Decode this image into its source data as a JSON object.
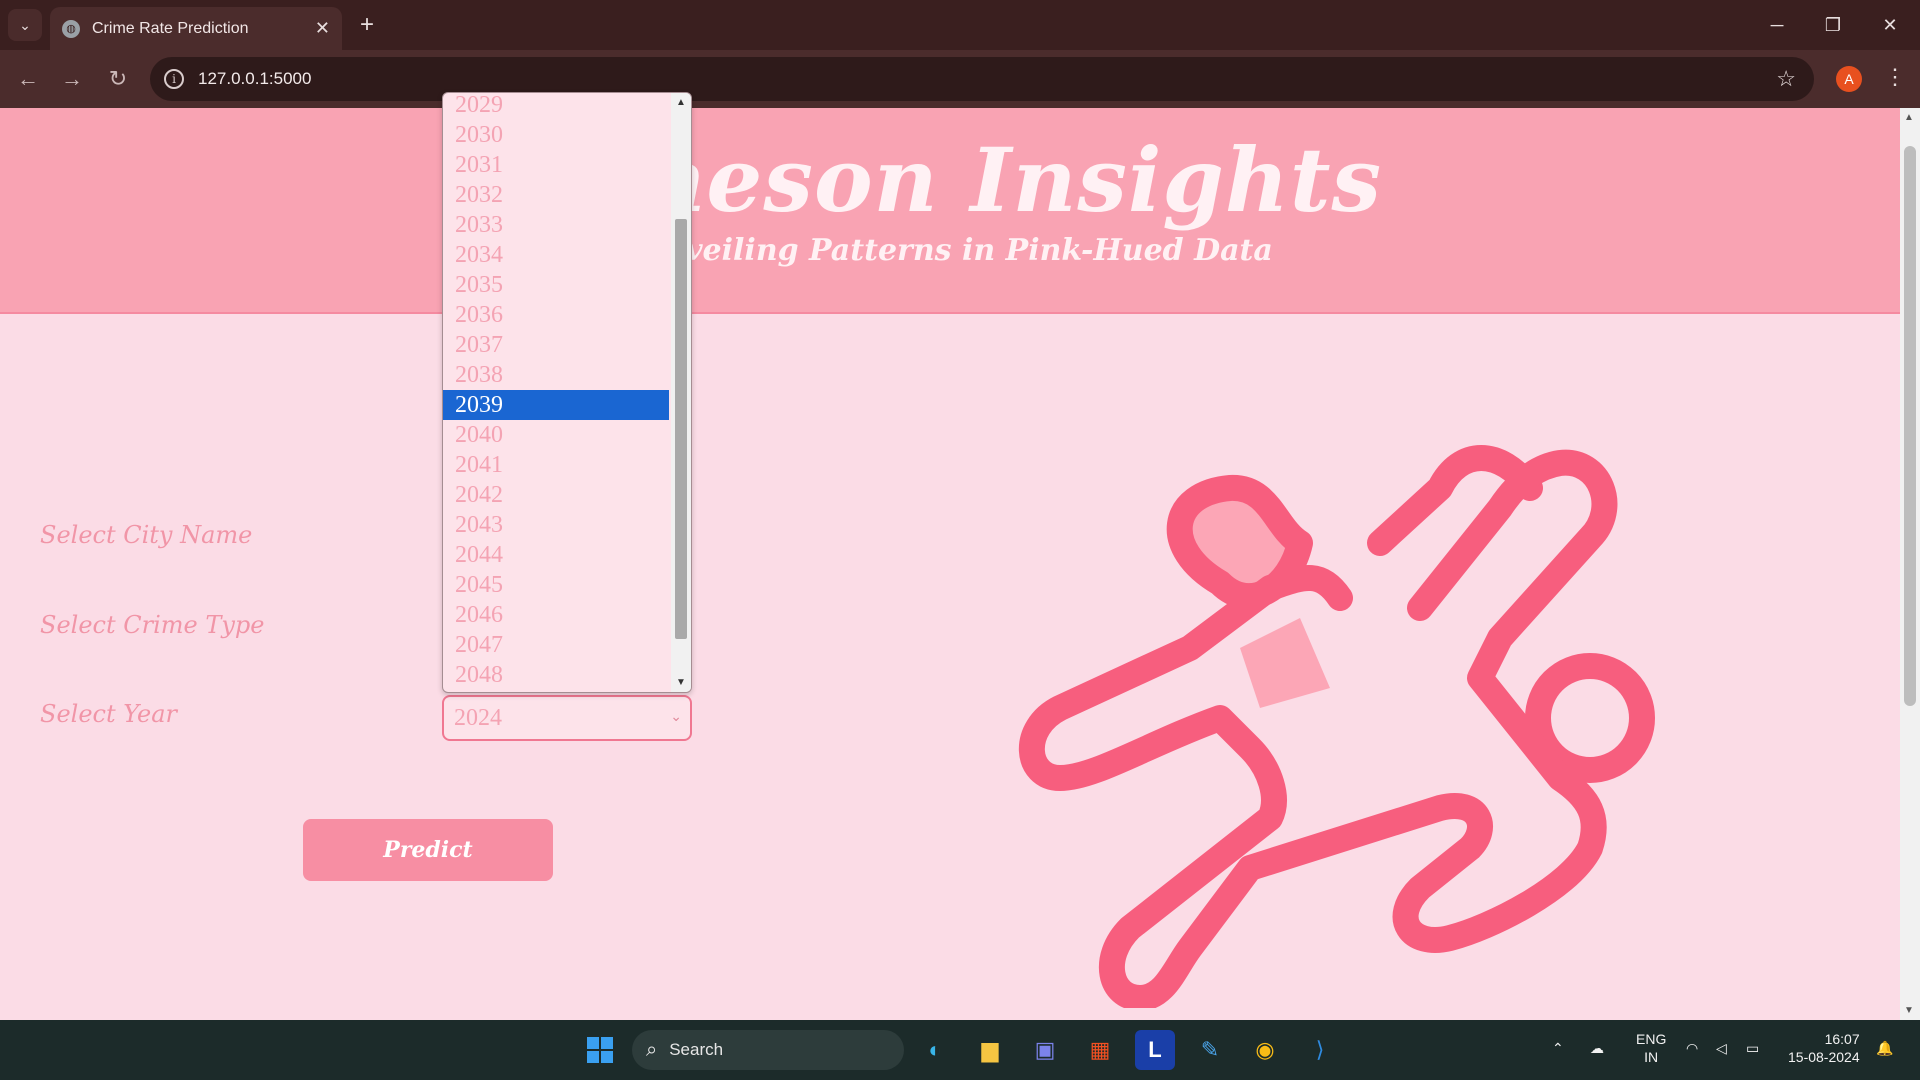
{
  "browser": {
    "tab_title": "Crime Rate Prediction",
    "url": "127.0.0.1:5000",
    "profile_initial": "A"
  },
  "hero": {
    "title": "imeson Insights",
    "subtitle": "Unveiling Patterns in Pink-Hued Data"
  },
  "form": {
    "city_label": "Select City Name",
    "crime_label": "Select Crime Type",
    "year_label": "Select Year",
    "year_value": "2024",
    "predict_label": "Predict"
  },
  "year_dropdown": {
    "options": [
      "2029",
      "2030",
      "2031",
      "2032",
      "2033",
      "2034",
      "2035",
      "2036",
      "2037",
      "2038",
      "2039",
      "2040",
      "2041",
      "2042",
      "2043",
      "2044",
      "2045",
      "2046",
      "2047",
      "2048"
    ],
    "highlighted": "2039"
  },
  "taskbar": {
    "search_label": "Search",
    "lang_top": "ENG",
    "lang_bottom": "IN",
    "time": "16:07",
    "date": "15-08-2024"
  },
  "colors": {
    "page_bg": "#fbdce6",
    "hero_bg": "#f9a3b3",
    "accent": "#f78ea3",
    "highlight": "#1a66d2"
  }
}
